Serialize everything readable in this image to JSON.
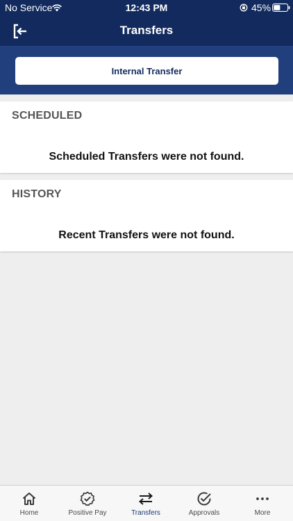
{
  "status_bar": {
    "carrier": "No Service",
    "time": "12:43 PM",
    "battery": "45%"
  },
  "nav": {
    "title": "Transfers",
    "exit_icon": "exit-icon"
  },
  "actions": {
    "internal_transfer_label": "Internal Transfer"
  },
  "scheduled": {
    "heading": "SCHEDULED",
    "empty_message": "Scheduled Transfers were not found."
  },
  "history": {
    "heading": "HISTORY",
    "empty_message": "Recent Transfers were not found."
  },
  "tabs": [
    {
      "label": "Home",
      "icon": "home-icon"
    },
    {
      "label": "Positive Pay",
      "icon": "badge-check-icon"
    },
    {
      "label": "Transfers",
      "icon": "transfer-arrows-icon",
      "active": true
    },
    {
      "label": "Approvals",
      "icon": "check-circle-icon"
    },
    {
      "label": "More",
      "icon": "more-dots-icon"
    }
  ],
  "colors": {
    "header": "#122a5e",
    "action_band": "#223f7d",
    "background": "#efeeef",
    "active_tab": "#1a3a6e"
  }
}
